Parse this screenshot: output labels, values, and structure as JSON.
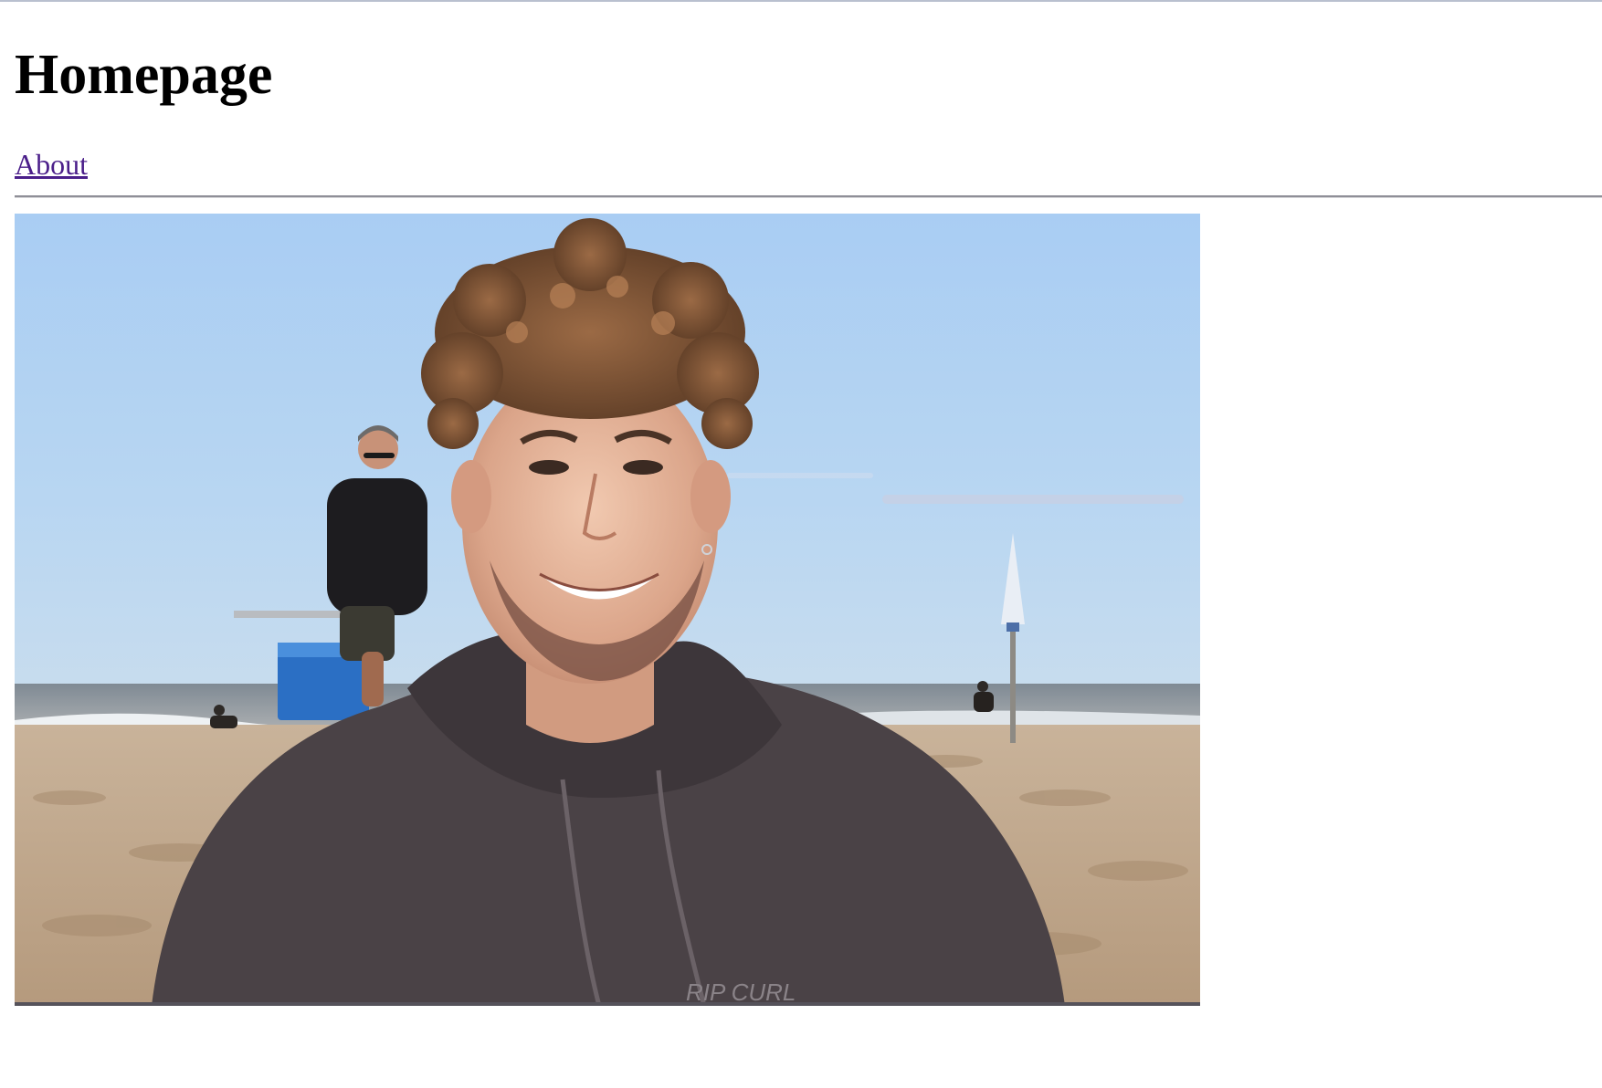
{
  "page": {
    "title": "Homepage"
  },
  "nav": {
    "about_label": "About"
  },
  "image": {
    "subject": "beach portrait photo"
  }
}
